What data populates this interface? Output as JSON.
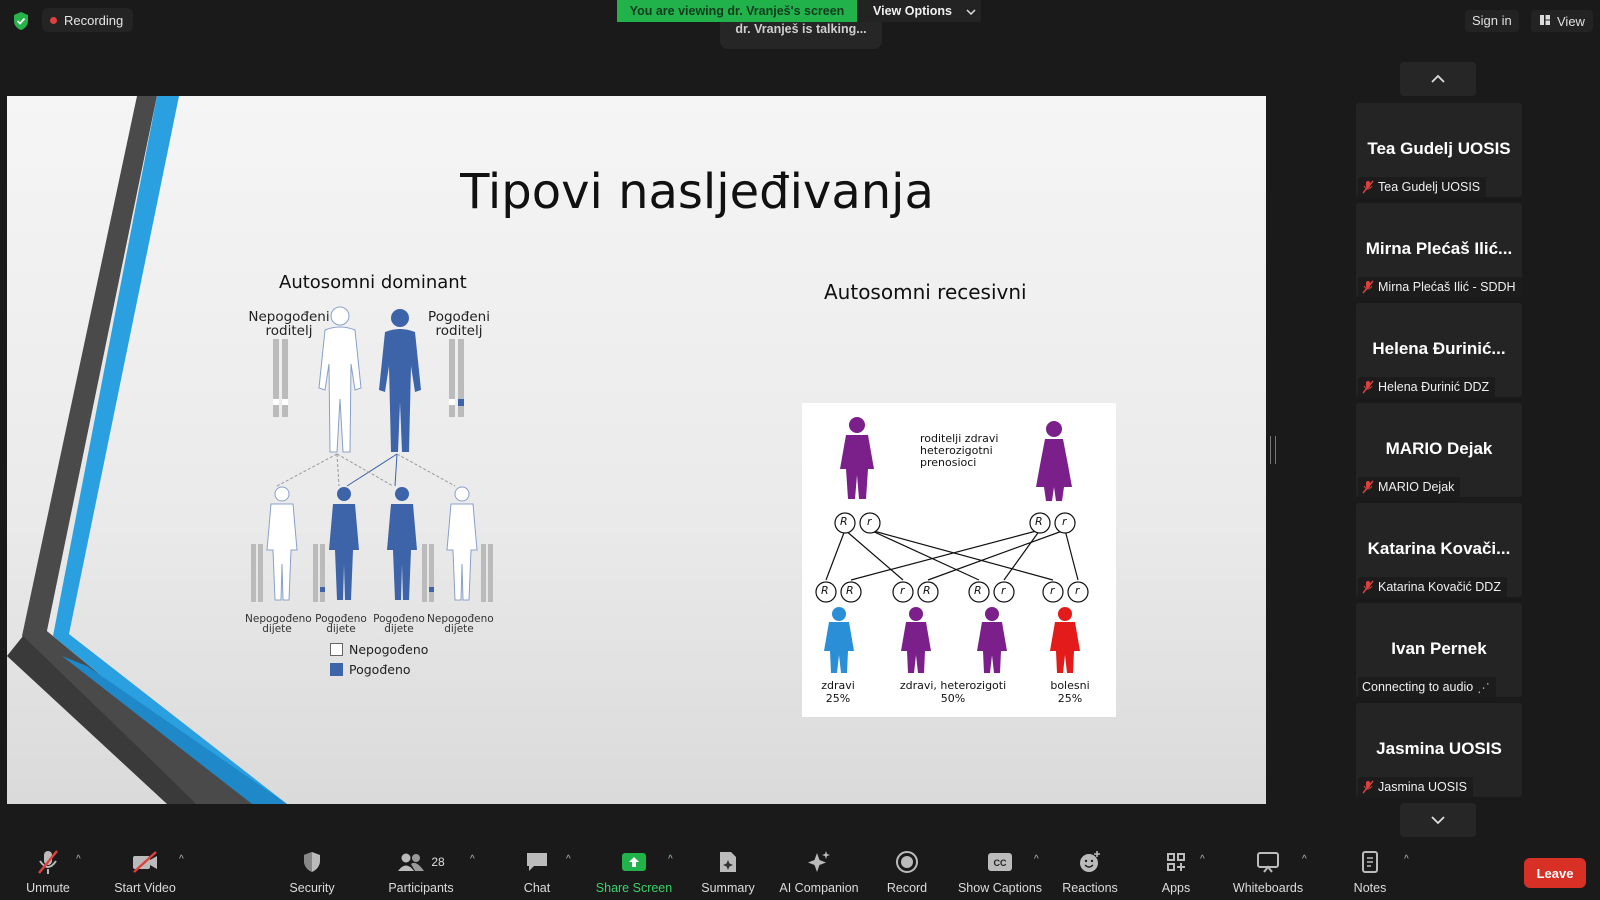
{
  "top_bar": {
    "recording_label": "Recording",
    "viewing_banner": "You are viewing dr. Vranješ's screen",
    "view_options_label": "View Options",
    "talking_label": "dr. Vranješ is talking...",
    "sign_in_label": "Sign in",
    "view_label": "View"
  },
  "slide": {
    "title": "Tipovi nasljeđivanja",
    "left_heading": "Autosomni dominant",
    "left_parent_unaffected": "Nepogođeni roditelj",
    "left_parent_affected": "Pogođeni roditelj",
    "children": [
      "Nepogođeno dijete",
      "Pogođeno dijete",
      "Pogođeno dijete",
      "Nepogođeno dijete"
    ],
    "legend_unaffected": "Nepogođeno",
    "legend_affected": "Pogođeno",
    "right_heading": "Autosomni recesivni",
    "recessive_parents_text": "roditelji zdravi heterozigotni prenosioci",
    "allele_dominant": "R",
    "allele_recessive": "r",
    "outcome_healthy": "zdravi",
    "outcome_healthy_pct": "25%",
    "outcome_carriers": "zdravi, heterozigoti",
    "outcome_carriers_pct": "50%",
    "outcome_sick": "bolesni",
    "outcome_sick_pct": "25%",
    "colors": {
      "affected": "#3d63a8",
      "unaffected": "#ffffff",
      "carrier": "#7b1f8a",
      "healthy": "#2a8fd6",
      "sick": "#e31b1b"
    }
  },
  "participants": [
    {
      "display": "Tea Gudelj UOSIS",
      "label": "Tea Gudelj UOSIS",
      "muted": true
    },
    {
      "display": "Mirna Plećaš Ilić...",
      "label": "Mirna Plećaš Ilić - SDDH",
      "muted": true
    },
    {
      "display": "Helena Đurinić...",
      "label": "Helena Đurinić DDZ",
      "muted": true
    },
    {
      "display": "MARIO Dejak",
      "label": "MARIO Dejak",
      "muted": true
    },
    {
      "display": "Katarina Kovači...",
      "label": "Katarina Kovačić DDZ",
      "muted": true
    },
    {
      "display": "Ivan Pernek",
      "label": "Connecting to audio",
      "muted": false
    },
    {
      "display": "Jasmina UOSIS",
      "label": "Jasmina UOSIS",
      "muted": true
    }
  ],
  "toolbar": {
    "unmute": "Unmute",
    "start_video": "Start Video",
    "security": "Security",
    "participants": "Participants",
    "participants_count": "28",
    "chat": "Chat",
    "share_screen": "Share Screen",
    "summary": "Summary",
    "ai_companion": "AI Companion",
    "record": "Record",
    "show_captions": "Show Captions",
    "reactions": "Reactions",
    "apps": "Apps",
    "whiteboards": "Whiteboards",
    "notes": "Notes",
    "leave": "Leave"
  }
}
